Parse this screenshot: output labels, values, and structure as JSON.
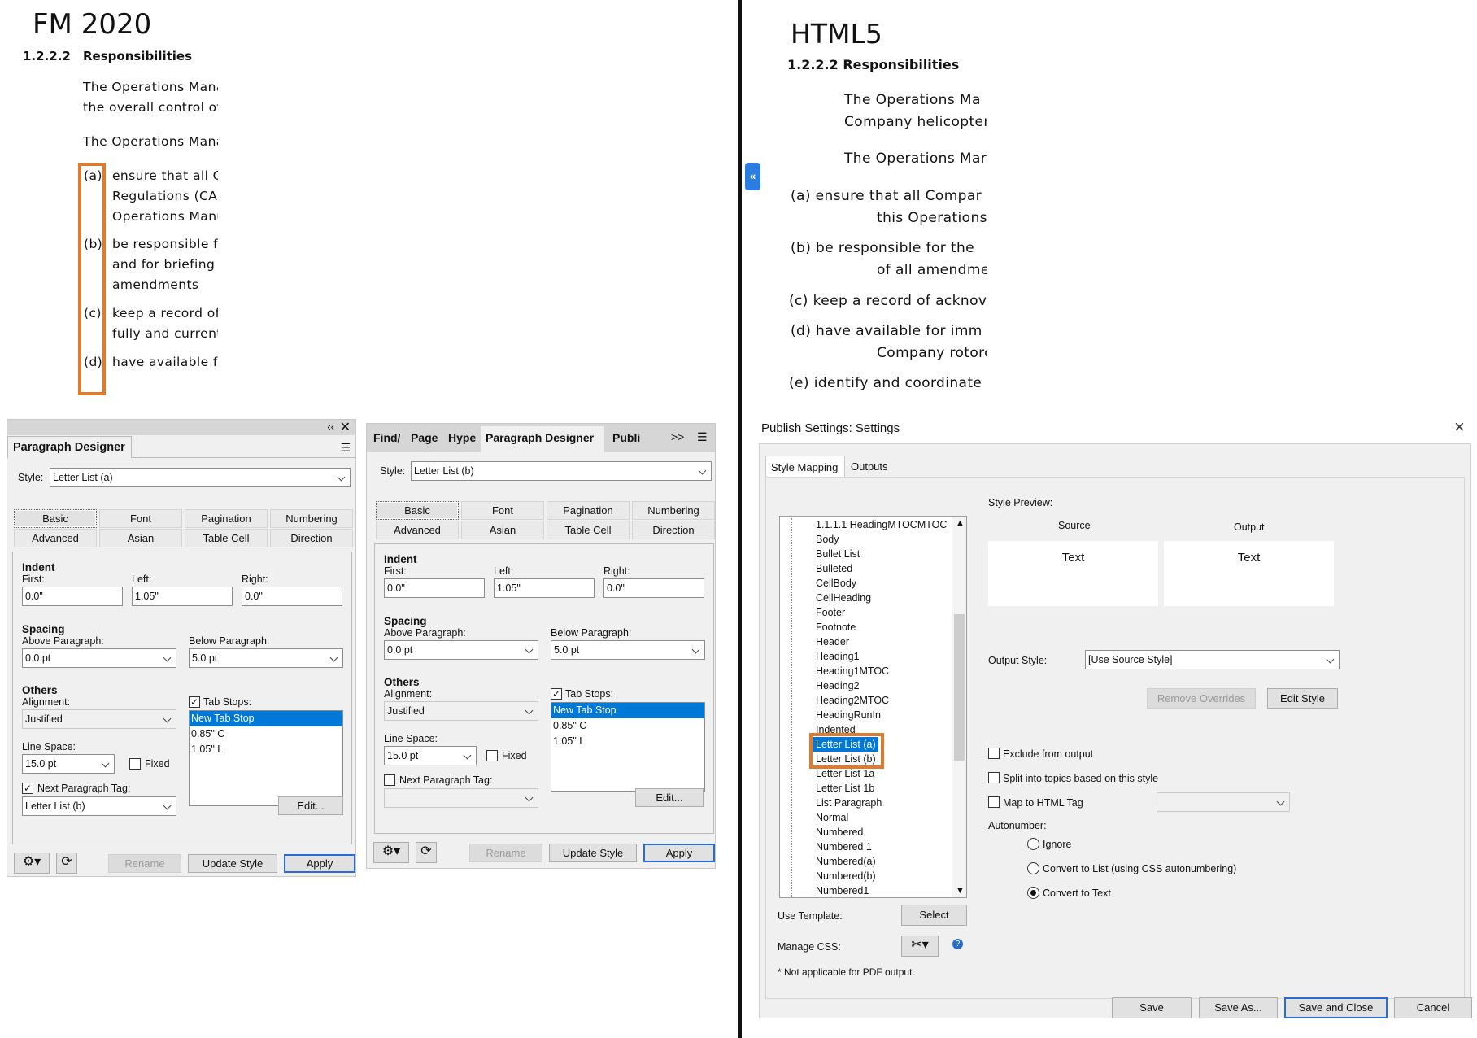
{
  "fm": {
    "title": "FM 2020",
    "heading_num": "1.2.2.2",
    "heading_text": "Responsibilities",
    "paras": [
      "The Operations Mana",
      "the overall control of",
      "The Operations Mana"
    ],
    "items": [
      {
        "letter": "(a)",
        "lines": [
          "ensure that all Co",
          "Regulations (CAF",
          "Operations Manu"
        ]
      },
      {
        "letter": "(b)",
        "lines": [
          "be responsible fo",
          "and for briefing",
          "amendments"
        ]
      },
      {
        "letter": "(c)",
        "lines": [
          "keep a record of",
          "fully and current"
        ]
      },
      {
        "letter": "(d)",
        "lines": [
          "have available f"
        ]
      }
    ]
  },
  "pd1": {
    "title": "Paragraph Designer",
    "style_label": "Style:",
    "style_value": "Letter List (a)",
    "tabs": [
      "Basic",
      "Font",
      "Pagination",
      "Numbering",
      "Advanced",
      "Asian",
      "Table Cell",
      "Direction"
    ],
    "indent": "Indent",
    "first": "First:",
    "left": "Left:",
    "right": "Right:",
    "first_val": "0.0\"",
    "left_val": "1.05\"",
    "right_val": "0.0\"",
    "spacing": "Spacing",
    "above": "Above Paragraph:",
    "below": "Below Paragraph:",
    "above_val": "0.0 pt",
    "below_val": "5.0 pt",
    "others": "Others",
    "alignment": "Alignment:",
    "alignment_val": "Justified",
    "tab_stops": "Tab Stops:",
    "tab_list": [
      "New Tab Stop",
      "0.85\"  C",
      "1.05\"  L"
    ],
    "line_space": "Line Space:",
    "line_space_val": "15.0 pt",
    "fixed": "Fixed",
    "next_tag": "Next Paragraph Tag:",
    "next_tag_val": "Letter List (b)",
    "edit": "Edit...",
    "rename": "Rename",
    "update": "Update Style",
    "apply": "Apply"
  },
  "pd2": {
    "top_tabs": [
      "Find/",
      "Page",
      "Hype",
      "Paragraph Designer",
      "Publi"
    ],
    "more": ">>",
    "style_label": "Style:",
    "style_value": "Letter List (b)",
    "tabs": [
      "Basic",
      "Font",
      "Pagination",
      "Numbering",
      "Advanced",
      "Asian",
      "Table Cell",
      "Direction"
    ],
    "indent": "Indent",
    "first": "First:",
    "left": "Left:",
    "right": "Right:",
    "first_val": "0.0\"",
    "left_val": "1.05\"",
    "right_val": "0.0\"",
    "spacing": "Spacing",
    "above": "Above Paragraph:",
    "below": "Below Paragraph:",
    "above_val": "0.0 pt",
    "below_val": "5.0 pt",
    "others": "Others",
    "alignment": "Alignment:",
    "alignment_val": "Justified",
    "tab_stops": "Tab Stops:",
    "tab_list": [
      "New Tab Stop",
      "0.85\"  C",
      "1.05\"  L"
    ],
    "line_space": "Line Space:",
    "line_space_val": "15.0 pt",
    "fixed": "Fixed",
    "next_tag": "Next Paragraph Tag:",
    "edit": "Edit...",
    "rename": "Rename",
    "update": "Update Style",
    "apply": "Apply"
  },
  "html5": {
    "title": "HTML5",
    "heading": "1.2.2.2  Responsibilities",
    "lines": [
      "The  Operations  Ma",
      "Company  helicopters",
      "The  Operations  Mar",
      "(a)  ensure  that  all  Compar",
      "this  Operations",
      "(b)  be  responsible  for  the",
      "of  all  amendme",
      "(c)  keep  a  record  of  acknov",
      "(d)  have  available  for  imm",
      "Company  rotorc",
      "(e)  identify  and  coordinate"
    ],
    "collapse": "«"
  },
  "dialog": {
    "title": "Publish Settings: Settings",
    "close": "×",
    "tabs": [
      "Style Mapping",
      "Outputs"
    ],
    "styles": [
      "1.1.1.1 HeadingMTOCMTOC",
      "Body",
      "Bullet List",
      "Bulleted",
      "CellBody",
      "CellHeading",
      "Footer",
      "Footnote",
      "Header",
      "Heading1",
      "Heading1MTOC",
      "Heading2",
      "Heading2MTOC",
      "HeadingRunIn",
      "Indented",
      "Letter List (a)",
      "Letter List (b)",
      "Letter List 1a",
      "Letter List 1b",
      "List Paragraph",
      "Normal",
      "Numbered",
      "Numbered 1",
      "Numbered(a)",
      "Numbered(b)",
      "Numbered1"
    ],
    "style_preview": "Style Preview:",
    "source": "Source",
    "output": "Output",
    "source_text": "Text",
    "output_text": "Text",
    "output_style_label": "Output Style:",
    "output_style_val": "[Use Source Style]",
    "remove_overrides": "Remove Overrides",
    "edit_style": "Edit Style",
    "exclude": "Exclude from output",
    "split": "Split into topics based on this style",
    "map_html": "Map to HTML Tag",
    "autonumber": "Autonumber:",
    "ignore": "Ignore",
    "convert_list": "Convert to List (using CSS autonumbering)",
    "convert_text": "Convert to Text",
    "use_template": "Use Template:",
    "select": "Select",
    "manage_css": "Manage CSS:",
    "note": "* Not applicable for PDF output.",
    "save": "Save",
    "save_as": "Save As...",
    "save_close": "Save and Close",
    "cancel": "Cancel"
  },
  "colors": {
    "accent_orange": "#e07a2e",
    "selection_blue": "#0078d7",
    "collapse_blue": "#2b7de0"
  }
}
